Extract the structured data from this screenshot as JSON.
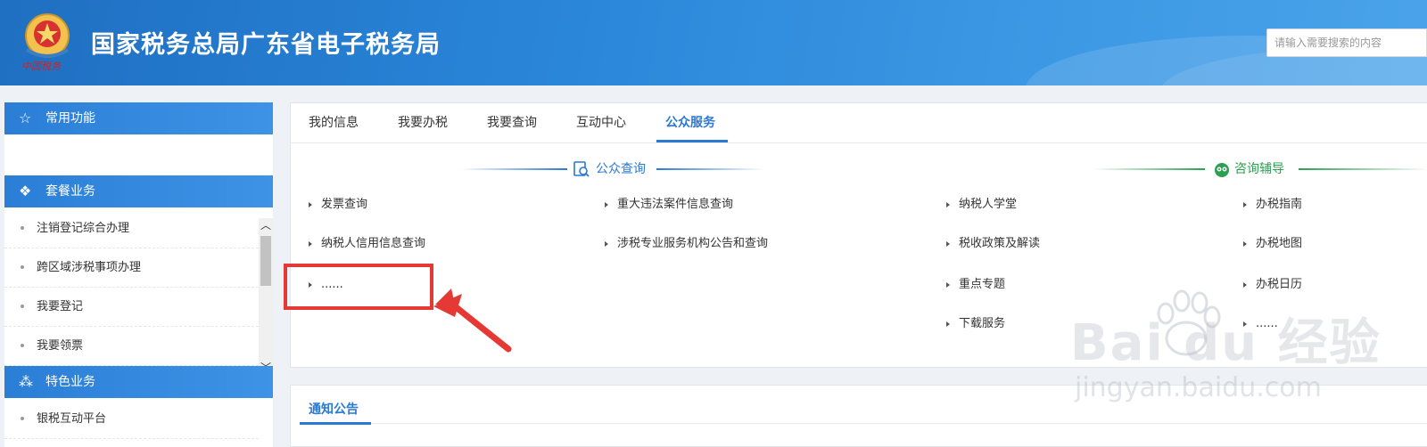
{
  "header": {
    "site_title": "国家税务总局广东省电子税务局",
    "logo_caption": "中国税务",
    "search_placeholder": "请输入需要搜索的内容"
  },
  "sidebar": {
    "section_common": "常用功能",
    "section_package": "套餐业务",
    "package_items": [
      "注销登记综合办理",
      "跨区域涉税事项办理",
      "我要登记",
      "我要领票"
    ],
    "section_special": "特色业务",
    "special_items": [
      "银税互动平台"
    ]
  },
  "tabs": [
    "我的信息",
    "我要办税",
    "我要查询",
    "互动中心",
    "公众服务"
  ],
  "active_tab": "公众服务",
  "public_query": {
    "title": "公众查询",
    "links": [
      "发票查询",
      "重大违法案件信息查询",
      "纳税人信用信息查询",
      "涉税专业服务机构公告和查询",
      "......"
    ]
  },
  "consult": {
    "title": "咨询辅导",
    "links": [
      "纳税人学堂",
      "办税指南",
      "税收政策及解读",
      "办税地图",
      "重点专题",
      "办税日历",
      "下载服务",
      "......"
    ]
  },
  "notice": {
    "title": "通知公告"
  },
  "watermark": {
    "brand": "Bai du 经验",
    "url": "jingyan.baidu.com"
  },
  "colors": {
    "header_blue": "#2a86d9",
    "accent_blue": "#2a79d2",
    "consult_green": "#2aa050",
    "annotation_red": "#e53935"
  }
}
